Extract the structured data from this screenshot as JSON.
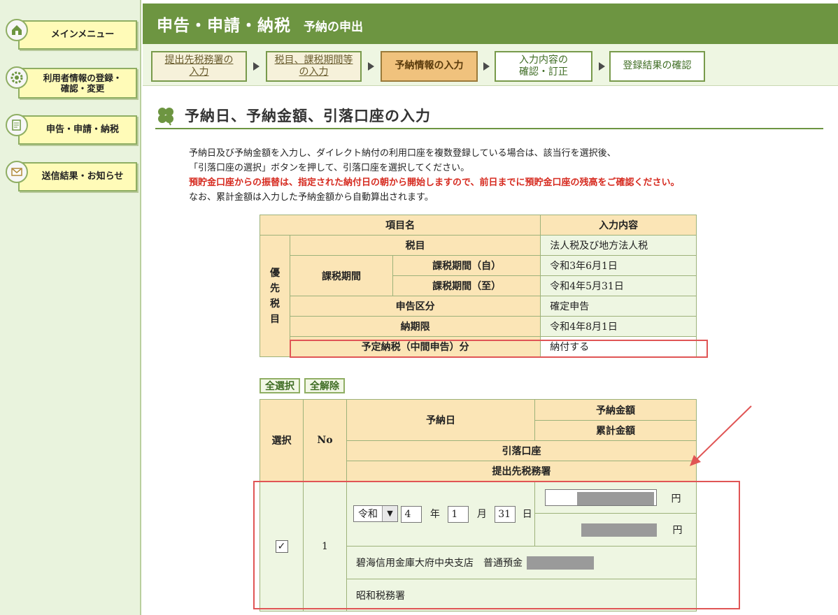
{
  "sidebar": {
    "items": [
      {
        "label": "メインメニュー",
        "icon": "home-icon"
      },
      {
        "label": "利用者情報の登録・\n確認・変更",
        "icon": "user-settings-icon"
      },
      {
        "label": "申告・申請・納税",
        "icon": "document-icon"
      },
      {
        "label": "送信結果・お知らせ",
        "icon": "mail-icon"
      }
    ]
  },
  "header": {
    "title": "申告・申請・納税",
    "subtitle": "予納の申出",
    "steps": [
      {
        "label": "提出先税務署の\n入力",
        "state": "done"
      },
      {
        "label": "税目、課税期間等\nの入力",
        "state": "done"
      },
      {
        "label": "予納情報の入力",
        "state": "current"
      },
      {
        "label": "入力内容の\n確認・訂正",
        "state": "todo"
      },
      {
        "label": "登録結果の確認",
        "state": "todo"
      }
    ]
  },
  "main": {
    "heading": "予納日、予納金額、引落口座の入力",
    "intro": {
      "line1": "予納日及び予納金額を入力し、ダイレクト納付の利用口座を複数登録している場合は、該当行を選択後、",
      "line2": "「引落口座の選択」ボタンを押して、引落口座を選択してください。",
      "line3": "預貯金口座からの振替は、指定された納付日の朝から開始しますので、前日までに預貯金口座の残高をご確認ください。",
      "line4": "なお、累計金額は入力した予納金額から自動算出されます。"
    },
    "info_table": {
      "col_item": "項目名",
      "col_value": "入力内容",
      "group_label": "優\n先\n税\n目",
      "zeimoku_label": "税目",
      "zeimoku_value": "法人税及び地方法人税",
      "kazei_label": "課税期間",
      "kazei_from_label": "課税期間（自）",
      "kazei_from_value": "令和3年6月1日",
      "kazei_to_label": "課税期間（至）",
      "kazei_to_value": "令和4年5月31日",
      "shinkoku_label": "申告区分",
      "shinkoku_value": "確定申告",
      "nouki_label": "納期限",
      "nouki_value": "令和4年8月1日",
      "yotei_label": "予定納税（中間申告）分",
      "yotei_value": "納付する"
    },
    "buttons": {
      "select_all": "全選択",
      "deselect_all": "全解除"
    },
    "payment_table": {
      "col_select": "選択",
      "col_no": "No",
      "col_date": "予納日",
      "col_amount": "予納金額",
      "col_total": "累計金額",
      "col_account": "引落口座",
      "col_office": "提出先税務署",
      "row": {
        "checked": "✓",
        "no": "1",
        "era": "令和",
        "year": "4",
        "year_unit": "年",
        "month": "1",
        "month_unit": "月",
        "day": "31",
        "day_unit": "日",
        "yen1": "円",
        "yen2": "円",
        "account": "碧海信用金庫大府中央支店　普通預金",
        "office": "昭和税務署"
      }
    }
  }
}
